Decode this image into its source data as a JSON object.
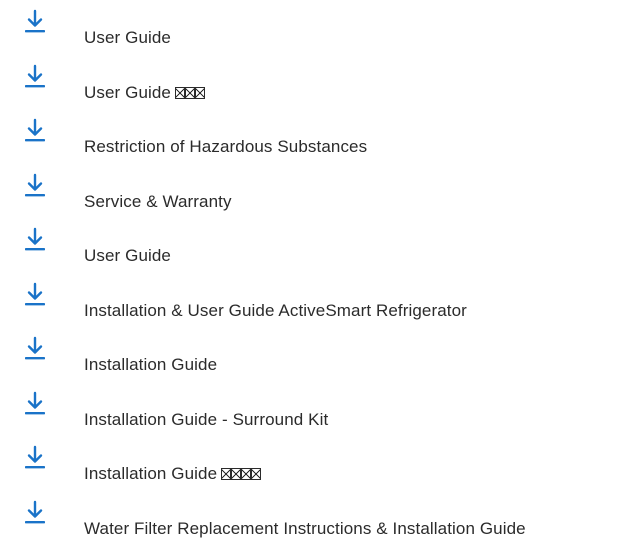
{
  "colors": {
    "icon_blue": "#1a73c8",
    "text": "#2b2b2b",
    "background": "#ffffff"
  },
  "documents": [
    {
      "label": "User Guide",
      "icon": "download-icon",
      "suffix_glyphs": 0
    },
    {
      "label": "User Guide",
      "icon": "download-icon",
      "suffix_glyphs": 3
    },
    {
      "label": "Restriction of Hazardous Substances",
      "icon": "download-icon",
      "suffix_glyphs": 0
    },
    {
      "label": "Service & Warranty",
      "icon": "download-icon",
      "suffix_glyphs": 0
    },
    {
      "label": "User Guide",
      "icon": "download-icon",
      "suffix_glyphs": 0
    },
    {
      "label": "Installation & User Guide ActiveSmart Refrigerator",
      "icon": "download-icon",
      "suffix_glyphs": 0
    },
    {
      "label": "Installation Guide",
      "icon": "download-icon",
      "suffix_glyphs": 0
    },
    {
      "label": "Installation Guide - Surround Kit",
      "icon": "download-icon",
      "suffix_glyphs": 0
    },
    {
      "label": "Installation Guide",
      "icon": "download-icon",
      "suffix_glyphs": 4
    },
    {
      "label": "Water Filter Replacement Instructions & Installation Guide",
      "icon": "download-icon",
      "suffix_glyphs": 0
    }
  ]
}
